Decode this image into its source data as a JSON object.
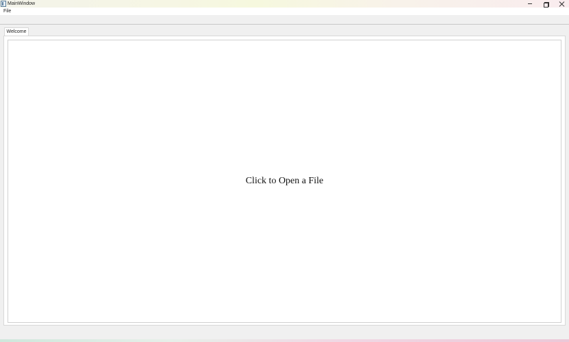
{
  "window": {
    "title": "MainWindow"
  },
  "menubar": {
    "file_label": "File"
  },
  "tabs": [
    {
      "label": "Welcome",
      "selected": true
    }
  ],
  "main": {
    "open_prompt": "Click to Open a File"
  },
  "icons": {
    "app": "app-icon",
    "minimize": "minimize-icon",
    "maximize": "restore-icon",
    "close": "close-icon"
  }
}
